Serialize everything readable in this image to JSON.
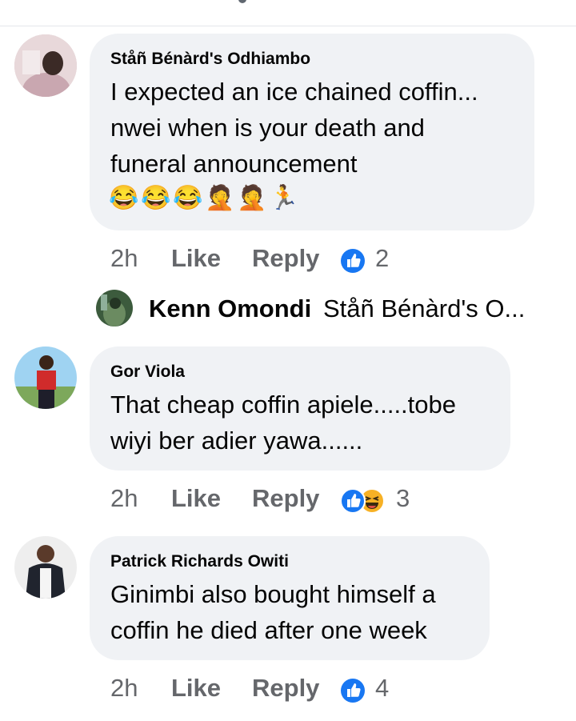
{
  "comments": [
    {
      "author": "Ståñ Bénàrd's Odhiambo",
      "lines": [
        "I expected an ice chained coffin...",
        "nwei when is your death and",
        "funeral announcement"
      ],
      "emojis": [
        "😂",
        "😂",
        "😂",
        "🤦",
        "🤦",
        "🏃"
      ],
      "time": "2h",
      "like": "Like",
      "reply": "Reply",
      "reaction_count": "2",
      "reactions": [
        "like-icon"
      ]
    },
    {
      "author": "Gor Viola",
      "lines": [
        "That cheap coffin apiele.....tobe",
        "wiyi ber adier yawa......"
      ],
      "time": "2h",
      "like": "Like",
      "reply": "Reply",
      "reaction_count": "3",
      "reactions": [
        "like-icon",
        "haha-icon"
      ]
    },
    {
      "author": "Patrick Richards Owiti",
      "lines": [
        "Ginimbi also bought himself a",
        "coffin he died after one week"
      ],
      "time": "2h",
      "like": "Like",
      "reply": "Reply",
      "reaction_count": "4",
      "reactions": [
        "like-icon"
      ]
    }
  ],
  "reply_preview": {
    "author": "Kenn Omondi",
    "snippet": "Ståñ Bénàrd's O...",
    "icon": "reply-avatar"
  },
  "colors": {
    "bubble": "#f0f2f5",
    "meta_text": "#65676b",
    "like_blue": "#1877f2",
    "haha_yellow": "#f7b125"
  }
}
